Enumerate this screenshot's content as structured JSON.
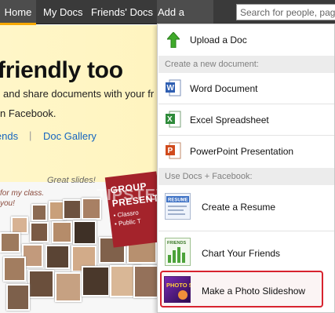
{
  "nav": {
    "home": "Home",
    "my_docs": "My Docs",
    "friends_docs": "Friends' Docs",
    "add_doc": "Add a Doc",
    "search_placeholder": "Search for people, pages, or",
    "accent_color": "#f7a800"
  },
  "page": {
    "headline": "friendly too",
    "intro_line1": "and share documents with your fr",
    "intro_line2": "n Facebook.",
    "link_friends": "iends",
    "link_separator": "|",
    "link_gallery": "Doc Gallery",
    "collage_caption": "Great slides!",
    "collage_quote1": "for my class.",
    "collage_quote2": "you!",
    "poster_line1": "GROUP",
    "poster_line2": "PRESENT",
    "poster_bullet1": "• Classro",
    "poster_bullet2": "• Public T",
    "watermark": "TIPSTEV.COM"
  },
  "dropdown": {
    "upload": "Upload a Doc",
    "create_header": "Create a new document:",
    "word": "Word Document",
    "excel": "Excel Spreadsheet",
    "powerpoint": "PowerPoint Presentation",
    "facebook_header": "Use Docs + Facebook:",
    "resume": "Create a Resume",
    "resume_icon_text": "RESUME",
    "chart": "Chart Your Friends",
    "chart_icon_text": "FRIENDS",
    "slideshow": "Make a Photo Slideshow",
    "slideshow_icon_text": "PHOTO SHOW",
    "highlight_color": "#d7232f"
  }
}
